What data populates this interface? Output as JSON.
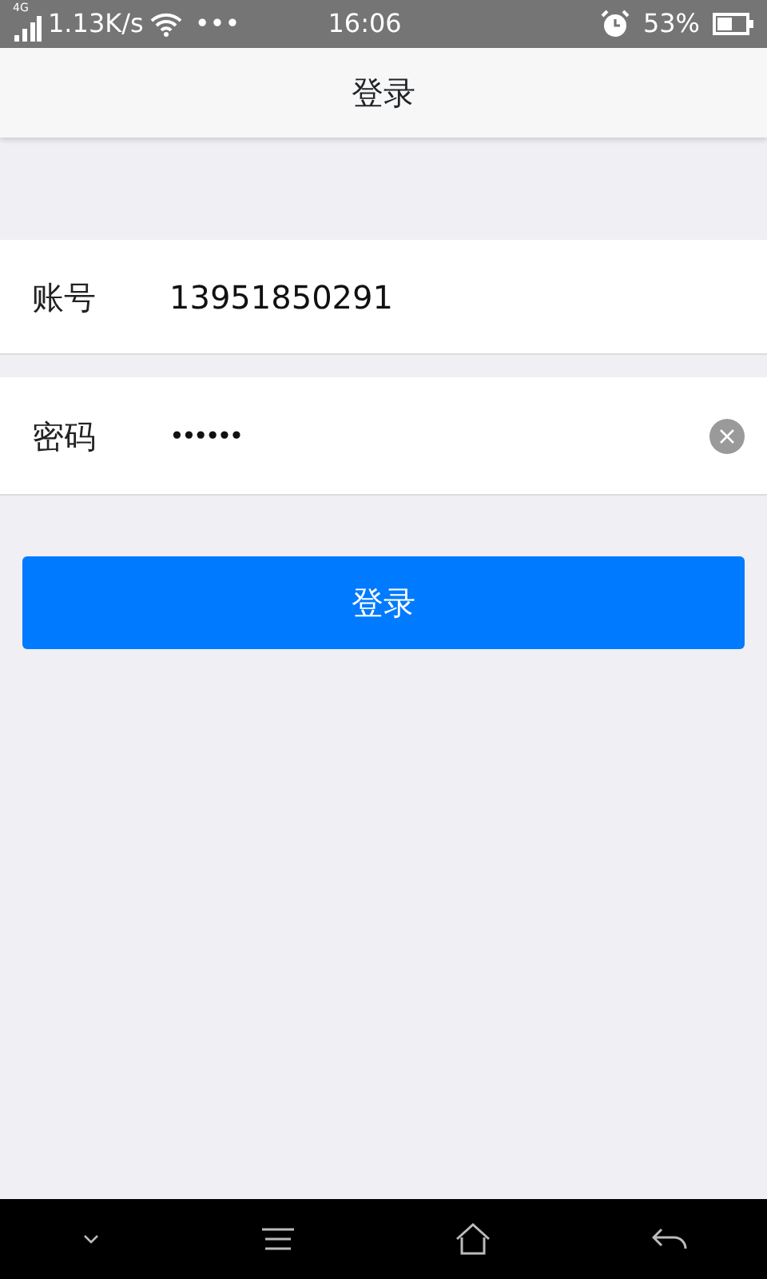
{
  "status_bar": {
    "network_type": "4G",
    "speed": "1.13K/s",
    "more": "•••",
    "time": "16:06",
    "battery": "53%"
  },
  "header": {
    "title": "登录"
  },
  "fields": [
    {
      "label": "账号",
      "value": "13951850291",
      "kind": "text",
      "clear_button": false
    },
    {
      "label": "密码",
      "value": "••••••",
      "kind": "password",
      "clear_button": true
    }
  ],
  "login_button": "登录"
}
